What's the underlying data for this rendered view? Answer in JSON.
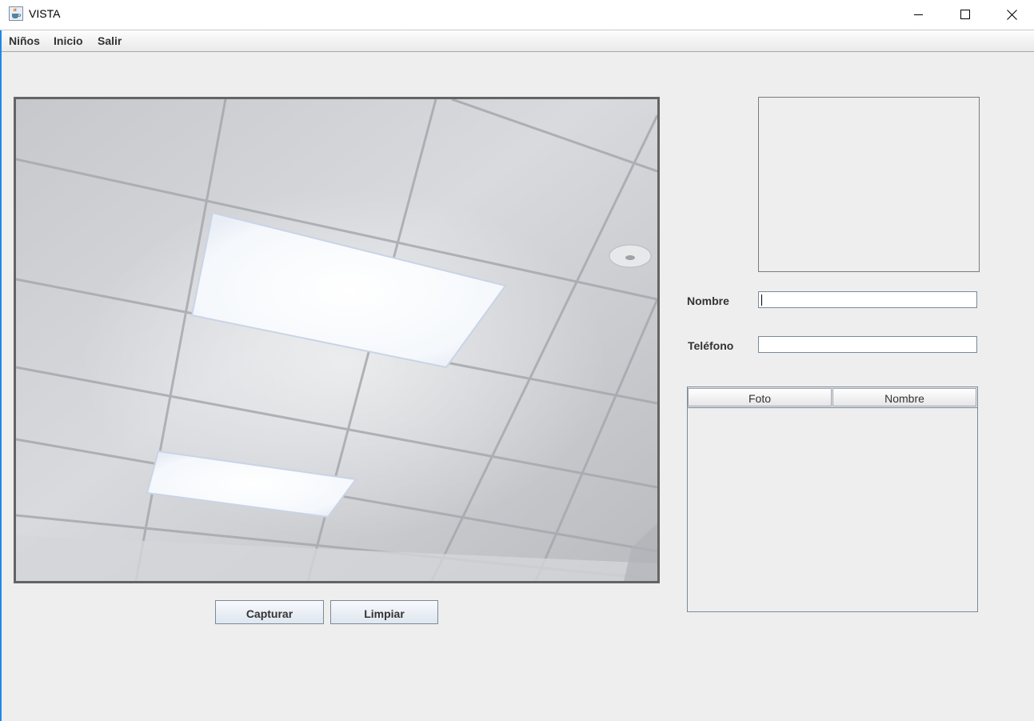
{
  "window": {
    "title": "VISTA",
    "icon": "java-coffee-icon",
    "controls": [
      "minimize-icon",
      "maximize-icon",
      "close-icon"
    ]
  },
  "menu": {
    "items": [
      {
        "label": "Niños"
      },
      {
        "label": "Inicio"
      },
      {
        "label": "Salir"
      }
    ]
  },
  "camera": {
    "content": "webcam-feed"
  },
  "buttons": {
    "capture": "Capturar",
    "clear": "Limpiar"
  },
  "form": {
    "nombre_label": "Nombre",
    "nombre_value": "",
    "telefono_label": "Teléfono",
    "telefono_value": ""
  },
  "table": {
    "columns": [
      "Foto",
      "Nombre"
    ],
    "rows": []
  },
  "colors": {
    "accent": "#1e88e5",
    "background": "#eeeeee"
  }
}
